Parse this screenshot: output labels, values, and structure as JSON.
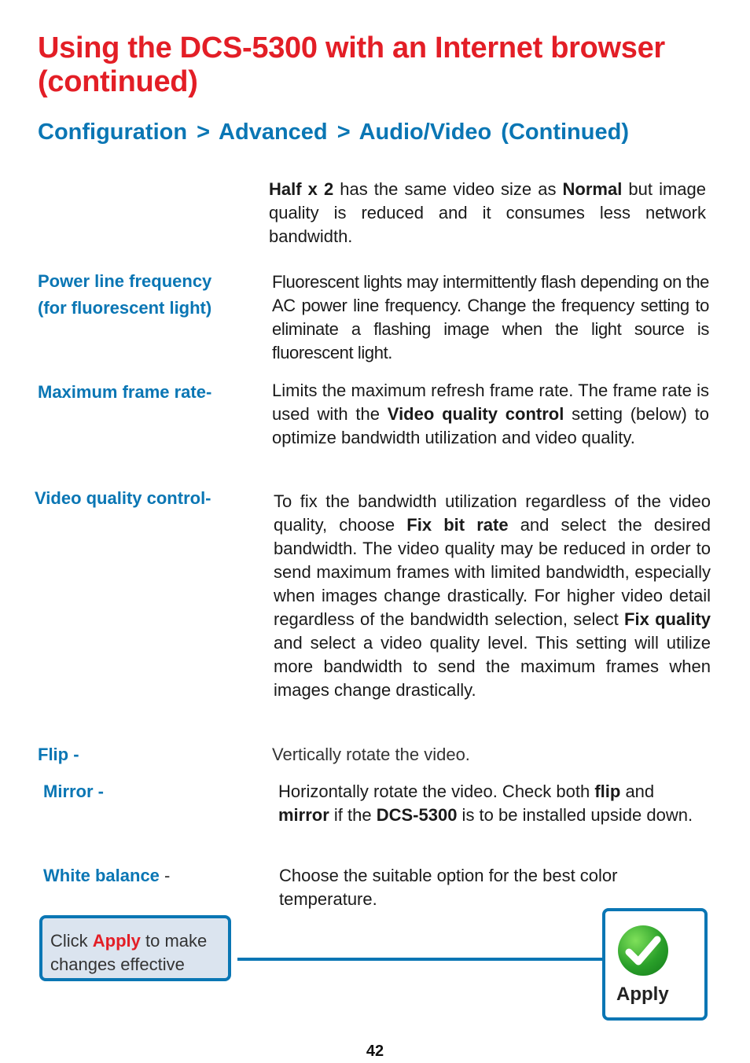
{
  "title": "Using the DCS-5300 with an Internet browser (continued)",
  "subtitle": "Configuration > Advanced > Audio/Video (Continued)",
  "intro": {
    "b1": "Half x 2",
    "t1": " has the same video size as ",
    "b2": "Normal",
    "t2": " but image quality is reduced and it consumes less network bandwidth."
  },
  "sections": {
    "power": {
      "label_line1": "Power line frequency",
      "label_line2": "(for fluorescent light)",
      "text": "Fluorescent lights may intermittently flash depending on the AC power line frequency. Change the frequency setting to eliminate a flashing image when the light source is fluorescent light."
    },
    "framerate": {
      "label": "Maximum frame rate-",
      "t1": "Limits the maximum refresh frame rate. The frame rate is used with the ",
      "b1": "Video quality control",
      "t2": " setting (below) to optimize bandwidth utilization and video quality."
    },
    "quality": {
      "label": "Video quality control-",
      "t1": "To fix the bandwidth utilization regardless of the video quality, choose ",
      "b1": "Fix bit rate",
      "t2": " and select the desired bandwidth. The video quality may be reduced in order to send maximum frames with limited bandwidth, especially when images change drastically. For higher video detail regardless of the bandwidth selection, select ",
      "b2": "Fix quality",
      "t3": " and select a video quality level. This setting will utilize more bandwidth to send the maximum frames when images change drastically."
    },
    "flip": {
      "label": "Flip -",
      "text": "Vertically rotate the video."
    },
    "mirror": {
      "label": "Mirror -",
      "t1": "Horizontally rotate the video. Check both ",
      "b1": "flip",
      "t2": " and ",
      "b2": "mirror",
      "t3": " if the ",
      "b3": "DCS-5300",
      "t4": " is to be installed upside down."
    },
    "whitebalance": {
      "label": "White balance",
      "dash": " -",
      "text": "Choose the suitable option for the best color temperature."
    }
  },
  "callout": {
    "t1": "Click ",
    "accent": "Apply",
    "t2": " to make changes effective"
  },
  "apply_button": {
    "label": "Apply",
    "icon": "check-icon"
  },
  "page_number": "42"
}
